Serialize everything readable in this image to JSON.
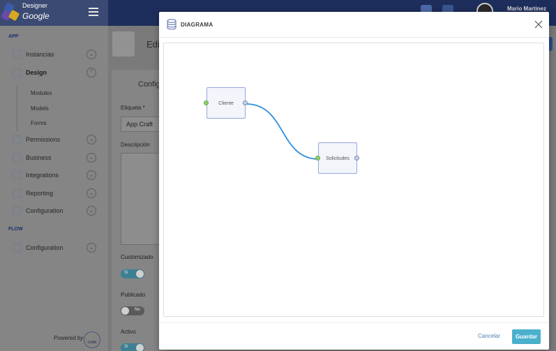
{
  "app": {
    "brand_line1": "Designer",
    "brand_line2": "Google",
    "user_name": "Mario Martinez"
  },
  "sidebar": {
    "section_app": "APP",
    "section_flow": "FLOW",
    "items": [
      {
        "label": "Instancias",
        "icon": "cube-icon"
      },
      {
        "label": "Design",
        "icon": "chart-icon"
      },
      {
        "label": "Permissions",
        "icon": "lock-icon"
      },
      {
        "label": "Business",
        "icon": "briefcase-icon"
      },
      {
        "label": "Integrations",
        "icon": "tools-icon"
      },
      {
        "label": "Reporting",
        "icon": "bar-chart-icon"
      },
      {
        "label": "Configuration",
        "icon": "gear-icon"
      }
    ],
    "design_subitems": [
      "Modules",
      "Models",
      "Forms"
    ],
    "flow_items": [
      {
        "label": "Configuration",
        "icon": "cube-icon"
      }
    ],
    "powered_by": "Powered by",
    "powered_logo": "code"
  },
  "main": {
    "title": "Edit",
    "card_title": "Configu",
    "etiqueta_label": "Etiqueta *",
    "etiqueta_value": "App Craft",
    "descripcion_label": "Descripción",
    "customizado_label": "Customizado",
    "customizado_value": "Sí",
    "publicado_label": "Publicado",
    "publicado_value": "No",
    "activo_label": "Activo",
    "activo_value": "Sí"
  },
  "modal": {
    "title": "DIAGRAMA",
    "nodes": [
      {
        "id": "cliente",
        "label": "Cliente"
      },
      {
        "id": "solicitudes",
        "label": "Solicitudes"
      }
    ],
    "connection": {
      "from": "Cliente",
      "to": "Solicitudes"
    },
    "cancel_label": "Cancelar",
    "save_label": "Guardar"
  },
  "colors": {
    "topbar": "#1e2e5c",
    "accent_save": "#4ab0cc",
    "link_blue": "#2f8fe0",
    "port_in": "#8fd16a",
    "node_border": "#95a6d9"
  }
}
